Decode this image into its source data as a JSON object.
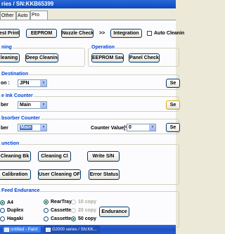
{
  "window": {
    "title": "ries / SN:KKB65399"
  },
  "tabs": [
    {
      "label": "Other"
    },
    {
      "label": "Auto"
    },
    {
      "label": "Pro"
    }
  ],
  "toolbar": {
    "test_print": "est Print",
    "eeprom": "EEPROM",
    "nozzle_check": "Nozzle Check",
    "arrows": ">>",
    "integration": "Integration",
    "auto_cleaning": "Auto Cleanin"
  },
  "cleaning_group": {
    "legend": "ning",
    "cleaning": "leaning",
    "deep_cleaning": "Deep Cleaning"
  },
  "operation_group": {
    "legend": "Operation",
    "eeprom_save": "EEPROM Save",
    "panel_check": "Panel Check"
  },
  "destination_group": {
    "legend": "Destination",
    "label": "on :",
    "value": "JPN",
    "set": "Se"
  },
  "ink_counter_group": {
    "legend": "e Ink Counter",
    "label": "ber",
    "value": "Main",
    "set": "Se"
  },
  "absorber_group": {
    "legend": "bsorber Counter",
    "label": "ber",
    "value": "Main",
    "counter_label": "Counter Value[%]",
    "counter_value": "0",
    "set": "Se"
  },
  "function_group": {
    "legend": "unction",
    "cleaning_bk": "Cleaning Bk",
    "cleaning_cl": "Cleaning Cl",
    "write_sn": "Write S/N",
    "calibration": "Calibration",
    "user_cleaning_off": "User Cleaning OFF",
    "error_status": "Error Status"
  },
  "feed_group": {
    "legend": "Feed Endurance",
    "paper": [
      {
        "label": "A4",
        "on": true
      },
      {
        "label": "Duplex",
        "on": false
      },
      {
        "label": "Hagaki",
        "on": false
      }
    ],
    "tray": [
      {
        "label": "RearTray",
        "on": true
      },
      {
        "label": "Cassette",
        "on": false
      },
      {
        "label": "Cassette",
        "on": false
      }
    ],
    "copies": [
      {
        "label": "10 copy",
        "on": false
      },
      {
        "label": "20 copy",
        "on": false
      },
      {
        "label": "50 copy",
        "on": true
      }
    ],
    "endurance": "Endurance"
  },
  "taskbar": {
    "items": [
      {
        "label": "untitled - Paint"
      },
      {
        "label": "G2000 series / SN:KK..."
      }
    ]
  }
}
